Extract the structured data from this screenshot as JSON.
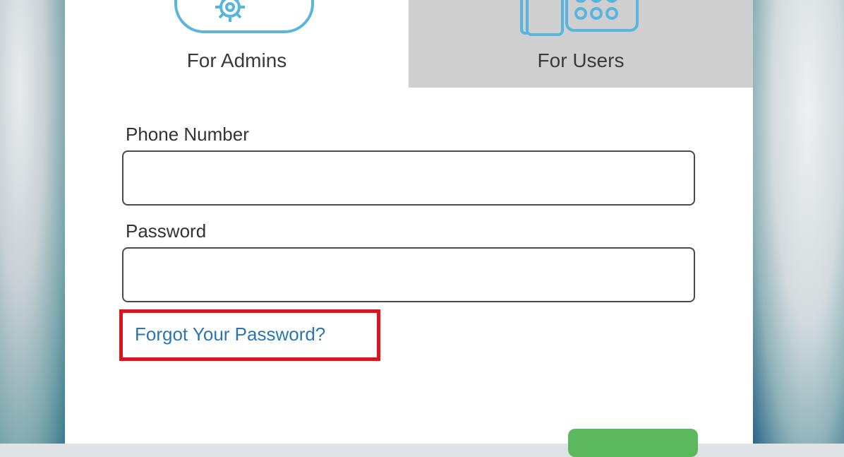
{
  "tabs": {
    "admins": {
      "label": "For Admins",
      "icon": "gear-icon"
    },
    "users": {
      "label": "For Users",
      "icon": "desk-phone-icon"
    }
  },
  "form": {
    "phone": {
      "label": "Phone Number",
      "value": "",
      "placeholder": ""
    },
    "password": {
      "label": "Password",
      "value": "",
      "placeholder": ""
    },
    "forgot_link": "Forgot Your Password?",
    "submit_label": ""
  },
  "colors": {
    "accent_blue": "#5ab4e0",
    "link_blue": "#2b76b2",
    "highlight_red": "#e0121b",
    "button_green": "#5cb85c",
    "inactive_tab": "#cfcfcf"
  }
}
